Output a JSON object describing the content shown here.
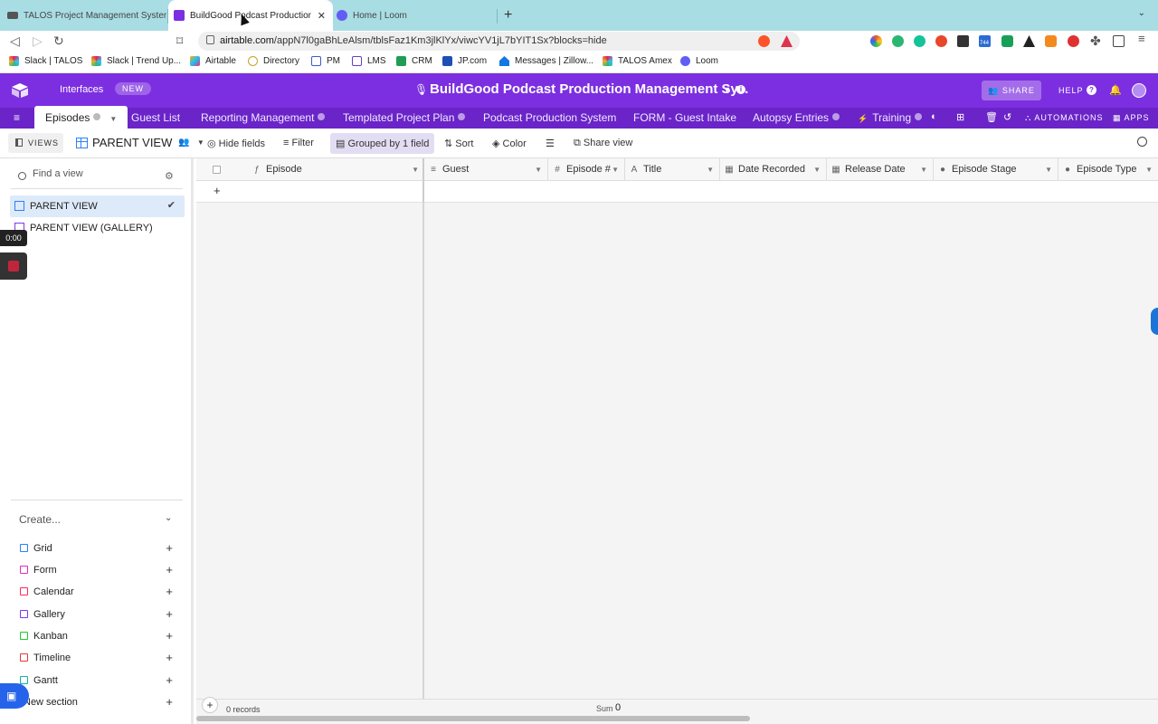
{
  "browser": {
    "tabs": [
      {
        "title": "TALOS Project Management System"
      },
      {
        "title": "BuildGood Podcast Production M"
      },
      {
        "title": "Home | Loom"
      }
    ],
    "url_domain": "airtable.com",
    "url_path": "/appN7l0gaBhLeAlsm/tblsFaz1Km3jlKlYx/viwcYV1jL7bYIT1Sx?blocks=hide",
    "ext_badge": "744",
    "bookmarks": [
      "Slack | TALOS",
      "Slack | Trend Up...",
      "Airtable",
      "Directory",
      "PM",
      "LMS",
      "CRM",
      "JP.com",
      "Messages | Zillow...",
      "TALOS Amex",
      "Loom"
    ]
  },
  "app": {
    "interfaces_label": "Interfaces",
    "new_badge": "NEW",
    "base_title": "BuildGood Podcast Production Management Sy...",
    "share_label": "SHARE",
    "help_label": "HELP",
    "tables": [
      "Episodes",
      "Guest List",
      "Reporting Management",
      "Templated Project Plan",
      "Podcast Production System",
      "FORM - Guest Intake",
      "Autopsy Entries",
      "Training"
    ],
    "automations_label": "AUTOMATIONS",
    "apps_label": "APPS"
  },
  "viewbar": {
    "views_label": "VIEWS",
    "current_view": "PARENT VIEW",
    "hide_fields": "Hide fields",
    "filter": "Filter",
    "grouped": "Grouped by 1 field",
    "sort": "Sort",
    "color": "Color",
    "share_view": "Share view"
  },
  "sidebar": {
    "find_placeholder": "Find a view",
    "views": [
      "PARENT VIEW",
      "PARENT VIEW (GALLERY)"
    ],
    "recording_time": "0:00",
    "create_label": "Create...",
    "create_items": [
      "Grid",
      "Form",
      "Calendar",
      "Gallery",
      "Kanban",
      "Timeline",
      "Gantt",
      "New section"
    ],
    "create_colors": [
      "#2d7ff9",
      "#e929ba",
      "#f82b60",
      "#7c39ed",
      "#20c933",
      "#e1392f",
      "#11b0a7",
      "#666666"
    ]
  },
  "grid": {
    "columns": [
      "Episode",
      "Guest",
      "Episode #",
      "Title",
      "Date Recorded",
      "Release Date",
      "Episode Stage",
      "Episode Type"
    ],
    "records_label": "0 records",
    "sum_label": "Sum",
    "sum_value": "0"
  }
}
